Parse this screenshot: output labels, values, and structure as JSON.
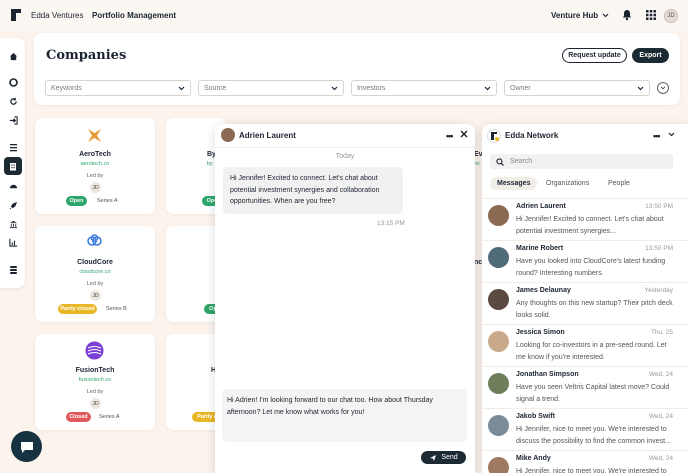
{
  "topbar": {
    "brand": "Edda Ventures",
    "nav_title": "Portfolio Management",
    "hub_label": "Venture Hub",
    "avatar_initials": "JD"
  },
  "page": {
    "title": "Companies",
    "request_update_label": "Request update",
    "export_label": "Export"
  },
  "filters": [
    {
      "placeholder": "Keywords"
    },
    {
      "placeholder": "Source"
    },
    {
      "placeholder": "Investors"
    },
    {
      "placeholder": "Owner"
    }
  ],
  "companies": [
    {
      "name": "AeroTech",
      "site": "aerotech.co",
      "led_by_label": "Led by",
      "lead_initials": "JD",
      "status": "Open",
      "status_color": "#2ea56a",
      "series": "Series A"
    },
    {
      "name": "CloudCore",
      "site": "cloudcore.co",
      "led_by_label": "Led by",
      "lead_initials": "JD",
      "status": "Partly closed",
      "status_color": "#e8b726",
      "series": "Series B"
    },
    {
      "name": "FusionTech",
      "site": "fusiontech.co",
      "led_by_label": "Led by",
      "lead_initials": "JD",
      "status": "Closed",
      "status_color": "#e05a5a",
      "series": "Series A"
    }
  ],
  "partial_cards": {
    "col2_name": "By",
    "col2_site": "by",
    "col2_badge1": "Ope",
    "col2_badge2": "Op",
    "col2_name3": "H",
    "col2_badge3": "Partly c",
    "col3_name": "Ev",
    "col3_site": "ev",
    "col3_name2": "nc"
  },
  "chat": {
    "contact": "Adrien Laurent",
    "day_label": "Today",
    "incoming_message": "Hi Jennifer! Excited to connect. Let's chat about potential investment synergies and collaboration opportunities. When are you free?",
    "incoming_time": "13:15 PM",
    "draft": "Hi Adrien! I'm looking forward to our chat too. How about Thursday afternoon? Let me know what works for you!",
    "send_label": "Send"
  },
  "network": {
    "title": "Edda Network",
    "search_placeholder": "Search",
    "tabs": [
      "Messages",
      "Organizations",
      "People"
    ],
    "conversations": [
      {
        "name": "Adrien Laurent",
        "time": "13:50 PM",
        "preview": "Hi Jennifer! Excited to connect. Let's chat about potential investment synergies...",
        "avatar_color": "#8a6a52"
      },
      {
        "name": "Marine Robert",
        "time": "13:50 PM",
        "preview": "Have you looked into CloudCore's latest funding round? Interesting numbers.",
        "avatar_color": "#4f6b78"
      },
      {
        "name": "James Delaunay",
        "time": "Yesterday",
        "preview": "Any thoughts on this new startup? Their pitch deck looks solid.",
        "avatar_color": "#5a4a42"
      },
      {
        "name": "Jessica Simon",
        "time": "Thu, 25",
        "preview": "Looking for co-investors in a pre-seed round. Let me know if you're interested.",
        "avatar_color": "#c9a98a"
      },
      {
        "name": "Jonathan Simpson",
        "time": "Wed, 24",
        "preview": "Have you seen Veltris Capital latest move? Could signal a trend.",
        "avatar_color": "#6e7d5a"
      },
      {
        "name": "Jakob Swift",
        "time": "Wed, 24",
        "preview": "Hi Jennifer, nice to meet you. We're interested to discuss the possibility to find the common invest...",
        "avatar_color": "#7b8c99"
      },
      {
        "name": "Mike Andy",
        "time": "Wed, 24",
        "preview": "Hi Jennifer, nice to meet you. We're interested to",
        "avatar_color": "#a07a60"
      }
    ]
  }
}
